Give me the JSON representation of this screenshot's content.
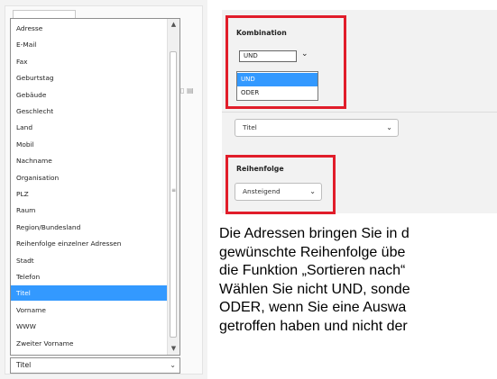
{
  "left_list": {
    "options": [
      "Adresse",
      "E-Mail",
      "Fax",
      "Geburtstag",
      "Gebäude",
      "Geschlecht",
      "Land",
      "Mobil",
      "Nachname",
      "Organisation",
      "PLZ",
      "Raum",
      "Region/Bundesland",
      "Reihenfolge einzelner Adressen",
      "Stadt",
      "Telefon",
      "Titel",
      "Vorname",
      "WWW",
      "Zweiter Vorname"
    ],
    "selected": "Titel",
    "combo_value": "Titel"
  },
  "kombination": {
    "label": "Kombination",
    "value": "UND",
    "options": [
      "UND",
      "ODER"
    ],
    "selected": "UND"
  },
  "field_select": {
    "value": "Titel"
  },
  "reihenfolge": {
    "label": "Reihenfolge",
    "value": "Ansteigend"
  },
  "paragraph": {
    "lines": [
      "Die Adressen bringen Sie in d",
      "gewünschte Reihenfolge übe",
      "die Funktion „Sortieren nach“",
      "Wählen Sie nicht UND, sonde",
      "ODER, wenn Sie eine Auswa",
      "getroffen haben und nicht der"
    ]
  },
  "colors": {
    "highlight": "#3399ff",
    "red_frame": "#e11d2a"
  }
}
